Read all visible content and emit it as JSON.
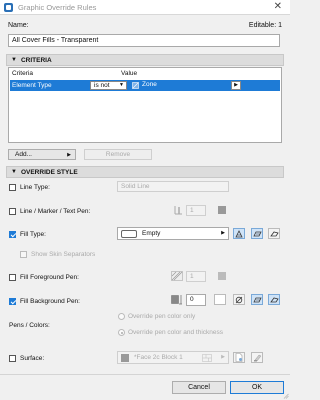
{
  "window": {
    "title": "Graphic Override Rules",
    "close_glyph": "✕"
  },
  "name_label": "Name:",
  "editable_label": "Editable: 1",
  "name_value": "All Cover Fills - Transparent",
  "criteria": {
    "header": "CRITERIA",
    "col_criteria": "Criteria",
    "col_value": "Value",
    "row": {
      "criteria": "Element Type",
      "operator": "is not",
      "value": "Zone"
    },
    "add_label": "Add...",
    "remove_label": "Remove"
  },
  "override": {
    "header": "OVERRIDE STYLE",
    "line_type": {
      "label": "Line Type:",
      "checked": false,
      "value": "Solid Line"
    },
    "line_pen": {
      "label": "Line / Marker / Text Pen:",
      "checked": false,
      "value": "1"
    },
    "fill_type": {
      "label": "Fill Type:",
      "checked": true,
      "value": "Empty"
    },
    "show_skin": {
      "label": "Show Skin Separators",
      "checked": false
    },
    "fill_fg_pen": {
      "label": "Fill Foreground Pen:",
      "checked": false,
      "value": "1"
    },
    "fill_bg_pen": {
      "label": "Fill Background Pen:",
      "checked": true,
      "value": "0"
    },
    "pens_colors": {
      "label": "Pens / Colors:",
      "option_1": "Override pen color only",
      "option_2": "Override pen color and thickness",
      "selected": "option_2"
    },
    "surface": {
      "label": "Surface:",
      "checked": false,
      "value": "*Face 2c Block 1"
    }
  },
  "footer": {
    "cancel_label": "Cancel",
    "ok_label": "OK"
  },
  "colors": {
    "accent": "#1e7bd6",
    "section_bg": "#dcdcdc"
  }
}
